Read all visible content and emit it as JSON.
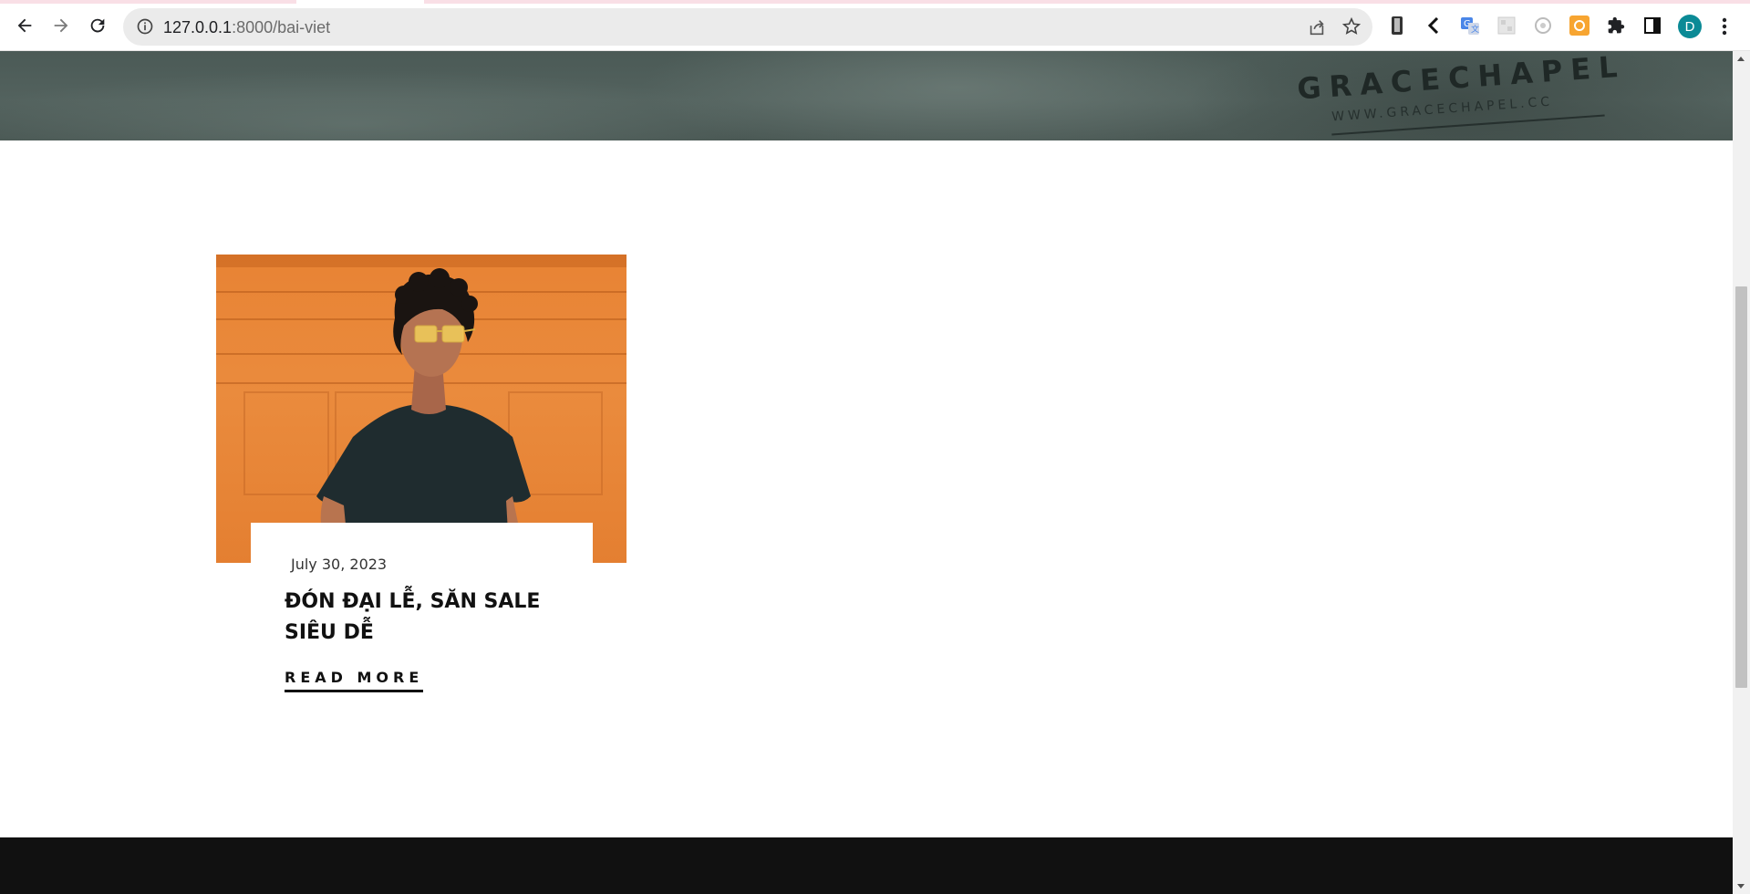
{
  "browser": {
    "url_host": "127.0.0.1",
    "url_path": ":8000/bai-viet",
    "profile_initial": "D",
    "icons": {
      "back": "arrow-left-icon",
      "forward": "arrow-right-icon",
      "reload": "reload-icon",
      "site_info": "info-icon",
      "share": "share-icon",
      "bookmark": "star-icon",
      "extensions": "puzzle-icon",
      "side_panel": "side-panel-icon",
      "menu": "more-vertical-icon"
    },
    "colors": {
      "avatar": "#0b8a96"
    }
  },
  "hero": {
    "brand_text": "GRACECHAPEL",
    "brand_url": "WWW.GRACECHAPEL.CC"
  },
  "post": {
    "date": "July 30, 2023",
    "title": "ĐÓN ĐẠI LỄ, SĂN SALE SIÊU DỄ",
    "read_more": "READ MORE",
    "image_accent": "#e88334"
  },
  "footer": {
    "color": "#111111"
  }
}
